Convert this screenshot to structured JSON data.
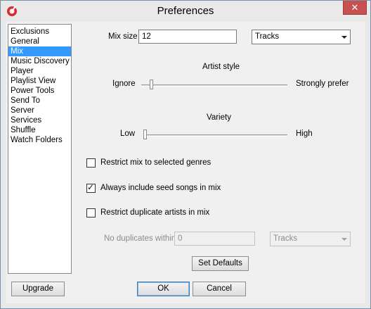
{
  "window": {
    "title": "Preferences",
    "close_glyph": "✕"
  },
  "sidebar": {
    "items": [
      {
        "label": "Exclusions"
      },
      {
        "label": "General"
      },
      {
        "label": "Mix",
        "selected": true
      },
      {
        "label": "Music Discovery"
      },
      {
        "label": "Player"
      },
      {
        "label": "Playlist View"
      },
      {
        "label": "Power Tools"
      },
      {
        "label": "Send To"
      },
      {
        "label": "Server"
      },
      {
        "label": "Services"
      },
      {
        "label": "Shuffle"
      },
      {
        "label": "Watch Folders"
      }
    ]
  },
  "mix": {
    "mix_size_label": "Mix size",
    "mix_size_value": "12",
    "unit_selected": "Tracks",
    "artist_style": {
      "title": "Artist style",
      "min_label": "Ignore",
      "max_label": "Strongly prefer",
      "level": 0.06
    },
    "variety": {
      "title": "Variety",
      "min_label": "Low",
      "max_label": "High",
      "level": 0.0
    },
    "restrict_genres": {
      "label": "Restrict mix to selected genres",
      "checked": false
    },
    "include_seed": {
      "label": "Always include seed songs in mix",
      "checked": true
    },
    "restrict_duplicates": {
      "label": "Restrict duplicate artists in mix",
      "checked": false
    },
    "no_duplicates_label": "No duplicates within",
    "no_duplicates_value": "0",
    "no_duplicates_unit": "Tracks",
    "set_defaults_label": "Set Defaults"
  },
  "footer": {
    "upgrade_label": "Upgrade",
    "ok_label": "OK",
    "cancel_label": "Cancel"
  },
  "colors": {
    "selection": "#3399ff",
    "close_button": "#c75050",
    "app_icon": "#e0262b"
  }
}
